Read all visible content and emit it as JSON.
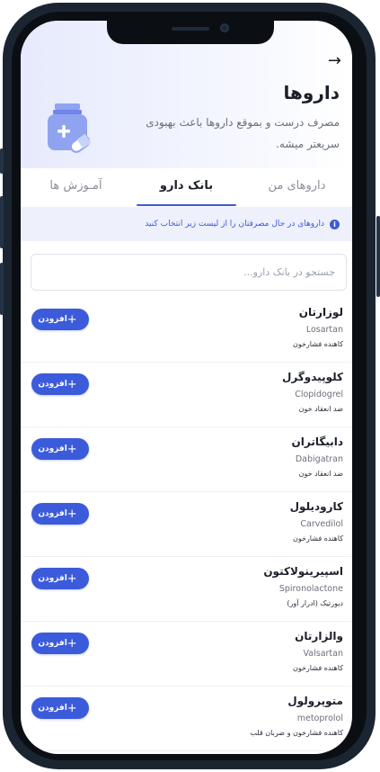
{
  "header": {
    "back_arrow": "→",
    "title": "داروها",
    "subtitle": "مصرف درست و بموقع داروها باعث بهبودی سریعتر میشه."
  },
  "tabs": [
    {
      "label": "داروهای من",
      "active": false
    },
    {
      "label": "بانک دارو",
      "active": true
    },
    {
      "label": "آمـوزش ها",
      "active": false
    }
  ],
  "info": {
    "icon": "i",
    "text": "داروهای در حال مصرفتان را از لیست زیر انتخاب کنید"
  },
  "search": {
    "placeholder": "جستجو در بانک دارو...",
    "value": ""
  },
  "add_label": "افزودن",
  "add_icon": "+",
  "drugs": [
    {
      "name": "لوزارتان",
      "english": "Losartan",
      "category": "کاهنده فشارخون"
    },
    {
      "name": "کلوپیدوگرل",
      "english": "Clopidogrel",
      "category": "ضد انعقاد خون"
    },
    {
      "name": "دابیگاتران",
      "english": "Dabigatran",
      "category": "ضد انعقاد خون"
    },
    {
      "name": "کارودیلول",
      "english": "Carvedilol",
      "category": "کاهنده فشارخون"
    },
    {
      "name": "اسپیرینولاکتون",
      "english": "Spironolactone",
      "category": "دیورتیک (ادرار آور)"
    },
    {
      "name": "والزارتان",
      "english": "Valsartan",
      "category": "کاهنده فشارخون"
    },
    {
      "name": "متوپرولول",
      "english": "metoprolol",
      "category": "کاهنده فشارخون و ضربان قلب"
    }
  ],
  "colors": {
    "accent": "#3b5bdb",
    "bottle": "#8fa3f0"
  }
}
